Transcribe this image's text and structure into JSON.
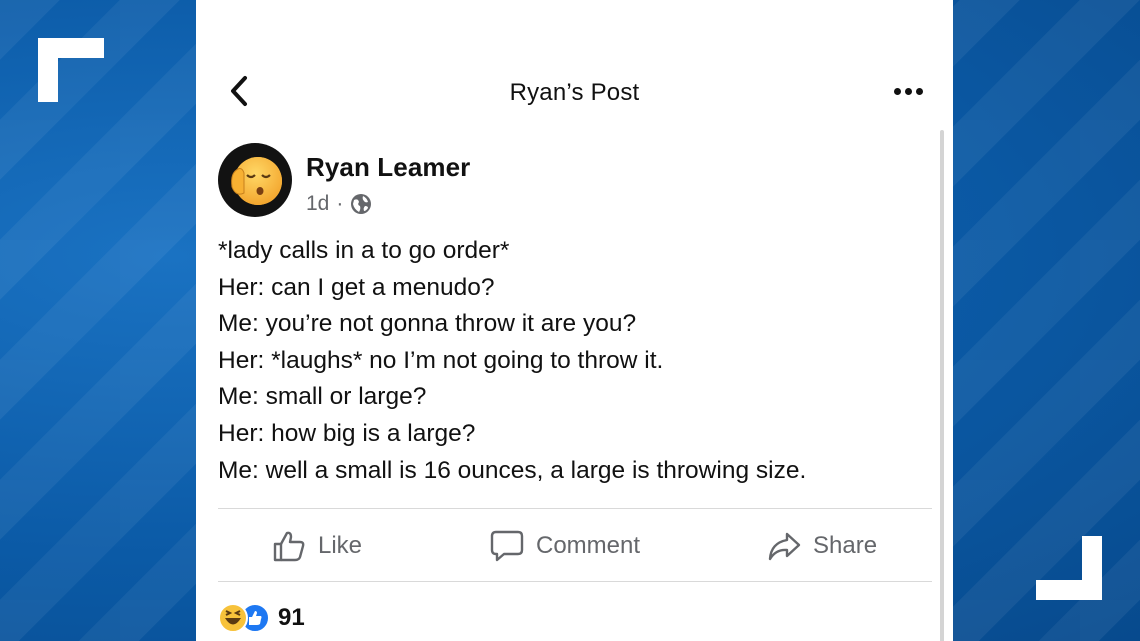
{
  "header": {
    "title": "Ryan’s Post",
    "back_icon": "chevron-left-icon",
    "more_icon": "more-horizontal-icon"
  },
  "post": {
    "author": "Ryan Leamer",
    "timestamp": "1d",
    "separator": "·",
    "privacy_icon": "globe-icon",
    "avatar_icon": "sleepy-face-emoji",
    "lines": [
      "*lady calls in a to go order*",
      "Her: can I get a menudo?",
      "Me: you’re not gonna throw it are you?",
      "Her: *laughs* no I’m not going to throw it.",
      "Me: small or large?",
      "Her: how big is a large?",
      "Me: well a small is 16 ounces, a large is throwing size."
    ]
  },
  "actions": {
    "like_label": "Like",
    "comment_label": "Comment",
    "share_label": "Share"
  },
  "reactions": {
    "count": "91",
    "icons": [
      "haha-reaction-icon",
      "like-reaction-icon"
    ]
  },
  "colors": {
    "background_blue": "#0b5aa6",
    "card": "#ffffff",
    "meta_gray": "#65676b",
    "like_blue": "#1e78f2",
    "haha_yellow": "#f7c23b"
  }
}
